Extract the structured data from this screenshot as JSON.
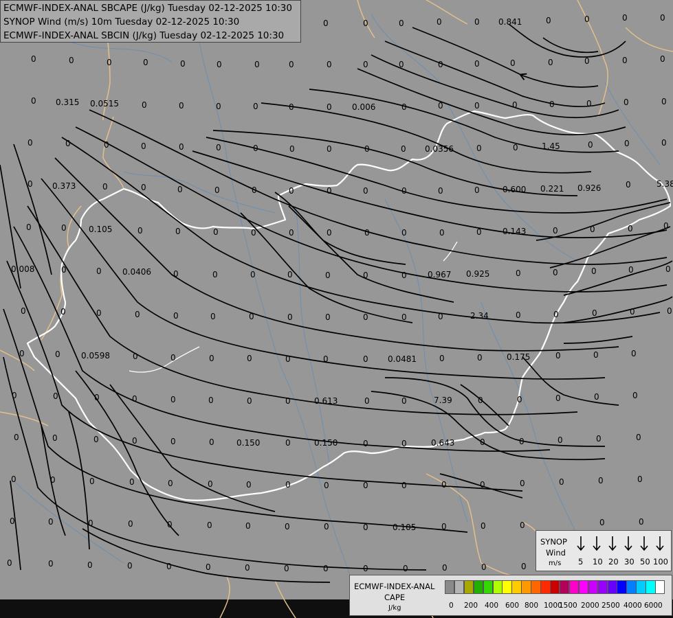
{
  "header": {
    "line1": "ECMWF-INDEX-ANAL SBCAPE (J/kg) Tuesday 02-12-2025 10:30",
    "line2": "SYNOP Wind (m/s) 10m Tuesday 02-12-2025 10:30",
    "line3": "ECMWF-INDEX-ANAL SBCIN (J/kg) Tuesday 02-12-2025 10:30"
  },
  "colors": {
    "background": "#979797",
    "border_national": "#ffffff",
    "border_other": "#e3c08a",
    "rivers": "#6c8fb0",
    "streamlines": "#000000"
  },
  "map_values": [
    "0",
    "0.841",
    "0.315",
    "0.0515",
    "0.006",
    "0.0356",
    "1.45",
    "0.600",
    "0.221",
    "0.926",
    "5.38",
    "0.373",
    "0.105",
    "0.143",
    "0.008",
    "0.0406",
    "0.967",
    "0.925",
    "2.34",
    "0.0598",
    "0.0481",
    "0.175",
    "0.613",
    "7.39",
    "0.150",
    "0.643",
    "0.105"
  ],
  "wind_legend": {
    "title": "SYNOP",
    "subtitle": "Wind",
    "unit": "m/s",
    "speeds": [
      "5",
      "10",
      "20",
      "30",
      "50",
      "100"
    ]
  },
  "cape_legend": {
    "title": "ECMWF-INDEX-ANAL",
    "subtitle": "CAPE",
    "unit": "J/kg",
    "ticks": [
      "0",
      "200",
      "400",
      "600",
      "800",
      "1000",
      "1500",
      "2000",
      "2500",
      "4000",
      "6000"
    ],
    "colors": [
      "#8a8a8a",
      "#b3b3b3",
      "#a8a800",
      "#21b000",
      "#33d900",
      "#b0ff00",
      "#ffff00",
      "#ffcc00",
      "#ff9900",
      "#ff6600",
      "#ff2a00",
      "#cc0000",
      "#b3005a",
      "#ff00cc",
      "#ff00ff",
      "#cc00ff",
      "#9900ff",
      "#6600ff",
      "#0000ff",
      "#0080ff",
      "#00ccff",
      "#00ffff",
      "#ffffff"
    ]
  }
}
